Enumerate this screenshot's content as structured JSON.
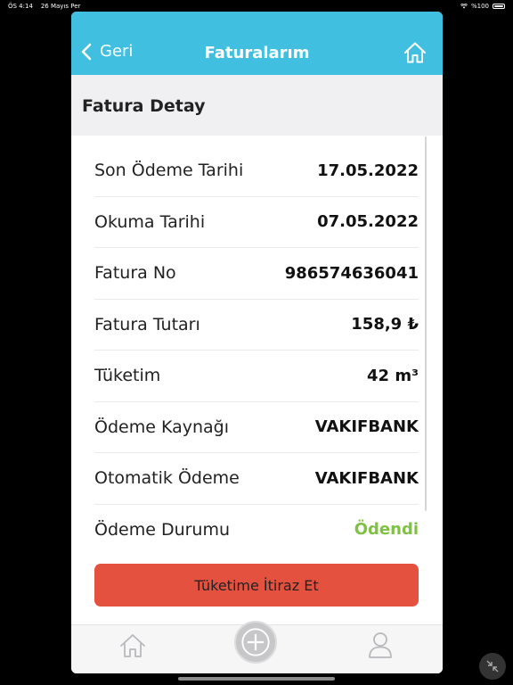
{
  "status_bar": {
    "time": "ÖS 4:14",
    "date": "26 Mayıs Per",
    "battery": "%100"
  },
  "nav": {
    "back_label": "Geri",
    "title": "Faturalarım"
  },
  "section": {
    "title": "Fatura Detay"
  },
  "details": [
    {
      "label": "Son Ödeme Tarihi",
      "value": "17.05.2022"
    },
    {
      "label": "Okuma Tarihi",
      "value": "07.05.2022"
    },
    {
      "label": "Fatura No",
      "value": "986574636041"
    },
    {
      "label": "Fatura Tutarı",
      "value": "158,9 ₺"
    },
    {
      "label": "Tüketim",
      "value": "42 m³"
    },
    {
      "label": "Ödeme Kaynağı",
      "value": "VAKIFBANK"
    },
    {
      "label": "Otomatik Ödeme",
      "value": "VAKIFBANK"
    },
    {
      "label": "Ödeme Durumu",
      "value": "Ödendi"
    }
  ],
  "actions": {
    "objection_label": "Tüketime İtiraz Et"
  },
  "icons": {
    "back": "chevron-left-icon",
    "home": "home-icon",
    "add": "plus-circle-icon",
    "user": "user-icon",
    "collapse": "collapse-arrows-icon"
  },
  "colors": {
    "nav_bg": "#40bfe0",
    "button_bg": "#e5513f",
    "paid_status": "#7ec143",
    "section_bg": "#f0f0f2"
  }
}
